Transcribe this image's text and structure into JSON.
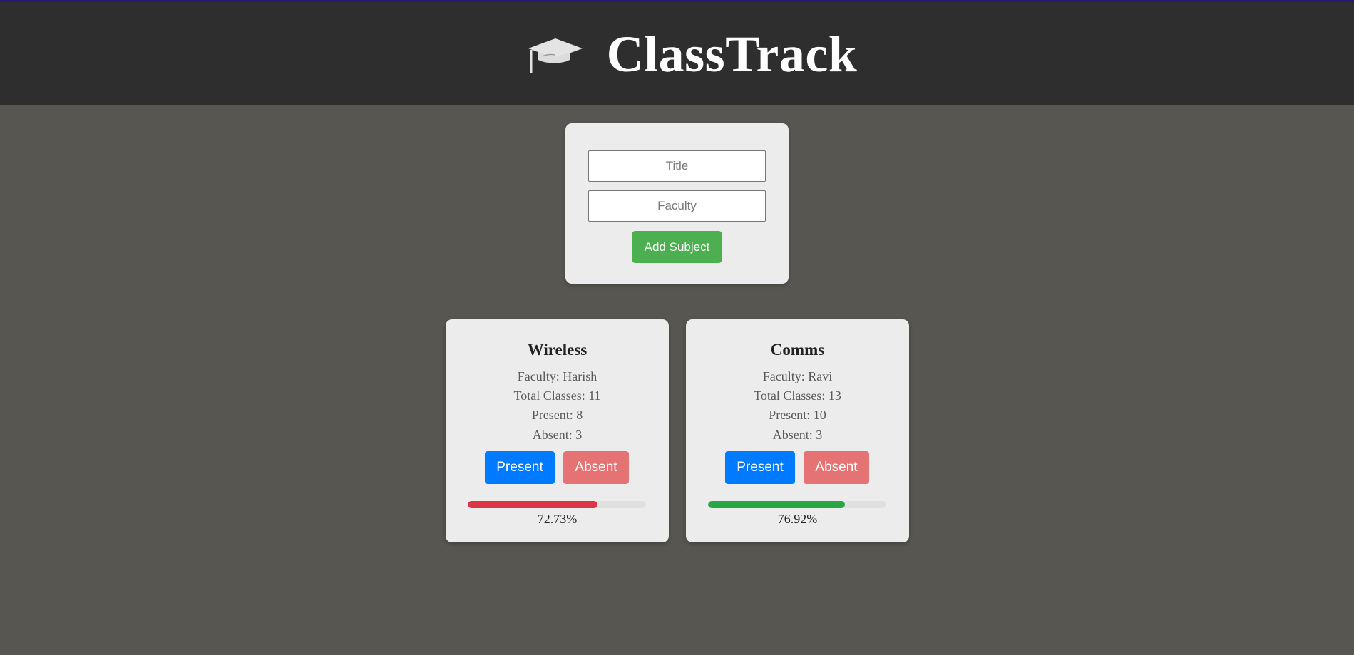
{
  "app": {
    "title": "ClassTrack",
    "icon": "graduation-cap-icon"
  },
  "form": {
    "title_placeholder": "Title",
    "faculty_placeholder": "Faculty",
    "add_button_label": "Add Subject"
  },
  "subjects": [
    {
      "title": "Wireless",
      "faculty": "Faculty: Harish",
      "total": "Total Classes: 11",
      "present": "Present: 8",
      "absent": "Absent: 3",
      "present_label": "Present",
      "absent_label": "Absent",
      "percent": 72.73,
      "percent_text": "72.73%",
      "bar_color": "#dc3545"
    },
    {
      "title": "Comms",
      "faculty": "Faculty: Ravi",
      "total": "Total Classes: 13",
      "present": "Present: 10",
      "absent": "Absent: 3",
      "present_label": "Present",
      "absent_label": "Absent",
      "percent": 76.92,
      "percent_text": "76.92%",
      "bar_color": "#28a745"
    }
  ],
  "colors": {
    "page_bg": "#575651",
    "header_bg": "#2e2e2e",
    "card_bg": "#ececec",
    "add_button": "#4caf50",
    "present_button": "#007bff",
    "absent_button": "#e57373",
    "track": "#e0e0e0"
  }
}
